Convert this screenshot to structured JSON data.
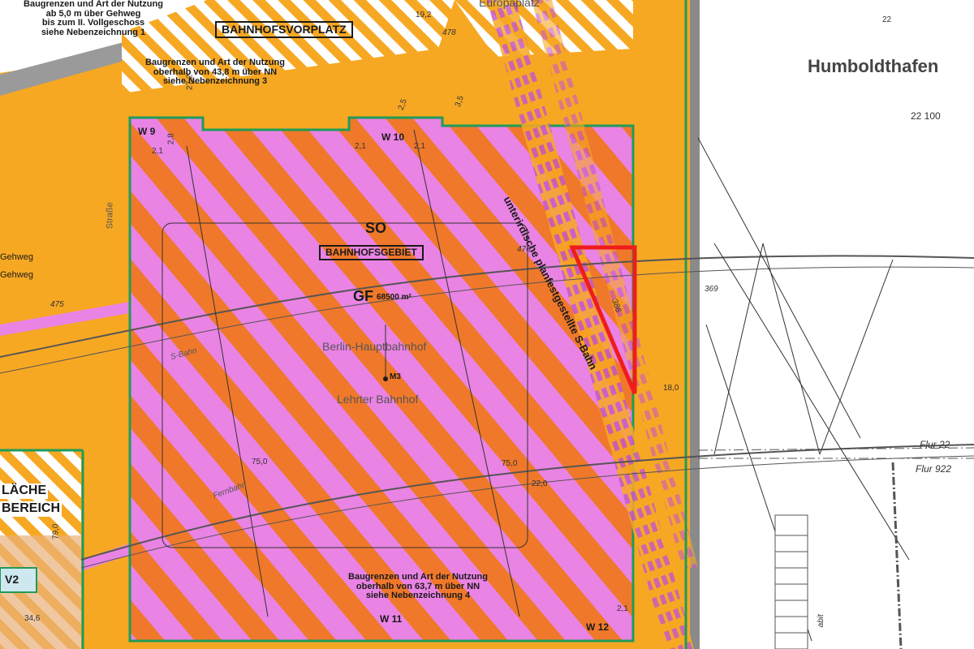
{
  "map": {
    "labels": {
      "note_top_left": "Baugrenzen und Art der Nutzung\nab 5,0 m über Gehweg\nbis zum II. Vollgeschoss\nsiehe Nebenzeichnung 1",
      "note_top_mid": "Baugrenzen und Art der Nutzung\noberhalb von 43,8 m über NN\nsiehe Nebenzeichnung 3",
      "note_bottom": "Baugrenzen und Art der Nutzung\noberhalb von 63,7 m über NN\nsiehe Nebenzeichnung 4",
      "bahnhofsvorplatz": "BAHNHOFSVORPLATZ",
      "europaplatz": "Europaplatz",
      "humboldthafen": "Humboldthafen",
      "so": "SO",
      "bahnhofsgebiet": "BAHNHOFSGEBIET",
      "gf_label": "GF",
      "gf_value": "68500 m²",
      "berlin_hauptbahnhof": "Berlin-Hauptbahnhof",
      "lehrter_bahnhof": "Lehrter Bahnhof",
      "m3": "M3",
      "strasse": "Straße",
      "gehweg1": "Gehweg",
      "gehweg2": "Gehweg",
      "s_bahn_trace": "unterirdische planfestgestellte S-Bahn",
      "flache": "LÄCHE",
      "bereich": "BEREICH",
      "w9": "W 9",
      "w10": "W 10",
      "w11": "W 11",
      "w12": "W 12",
      "v2": "V2",
      "flur22": "Flur 22",
      "flur922": "Flur 922",
      "fernbahn": "Fernbahn",
      "s_bahn": "S-Bahn",
      "n_22": "22",
      "n_22100": "22 100",
      "n_369": "369",
      "n_475": "475",
      "n_478": "478",
      "n_19_2": "19,2",
      "n_27_2": "27,2",
      "n_3_5": "3,5",
      "n_2_5": "2,5",
      "n_2_1a": "2,1",
      "n_2_1b": "2,1",
      "n_2_1c": "2,1",
      "n_2_1d": "2,1",
      "n_2_8": "2,8",
      "n_75a": "75,0",
      "n_75b": "75,0",
      "n_22_0": "22,0",
      "n_18_0": "18,0",
      "n_79_0": "79,0",
      "n_34_6": "34,6",
      "n_386": "386",
      "n_476": "476",
      "abit": "abit"
    },
    "colors": {
      "orange_zone": "#f7a823",
      "pink_zone": "#e983e4",
      "stripe_orange": "#f0782a",
      "green_border": "#1f9b58",
      "red_marker": "#f01c1c",
      "white_band": "#ffffff",
      "grey_road": "#8a8a8a"
    }
  }
}
